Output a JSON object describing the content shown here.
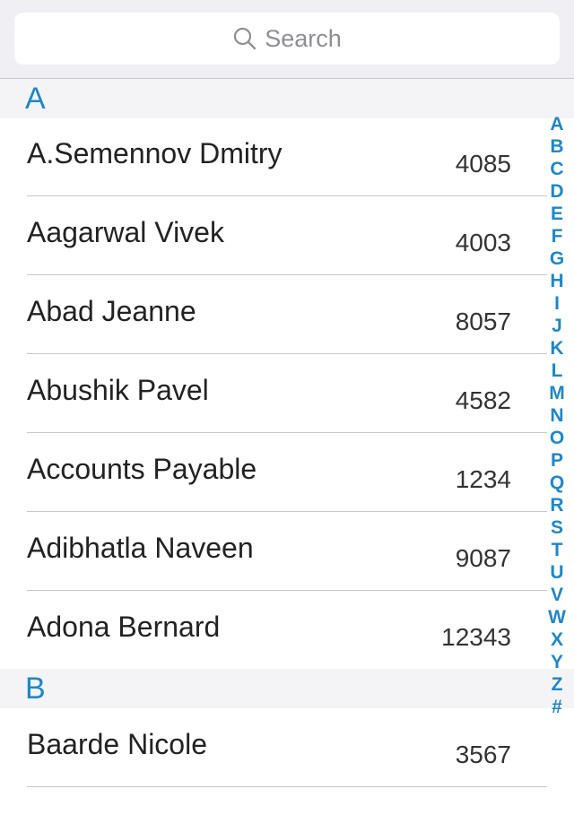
{
  "search": {
    "placeholder": "Search"
  },
  "sections": [
    {
      "letter": "A",
      "rows": [
        {
          "name": "A.Semennov Dmitry",
          "ext": "4085"
        },
        {
          "name": "Aagarwal Vivek",
          "ext": "4003"
        },
        {
          "name": "Abad Jeanne",
          "ext": "8057"
        },
        {
          "name": "Abushik Pavel",
          "ext": "4582"
        },
        {
          "name": "Accounts Payable",
          "ext": "1234"
        },
        {
          "name": "Adibhatla Naveen",
          "ext": "9087"
        },
        {
          "name": "Adona Bernard",
          "ext": "12343"
        }
      ]
    },
    {
      "letter": "B",
      "rows": [
        {
          "name": "Baarde Nicole",
          "ext": "3567"
        }
      ]
    }
  ],
  "index": [
    "A",
    "B",
    "C",
    "D",
    "E",
    "F",
    "G",
    "H",
    "I",
    "J",
    "K",
    "L",
    "M",
    "N",
    "O",
    "P",
    "Q",
    "R",
    "S",
    "T",
    "U",
    "V",
    "W",
    "X",
    "Y",
    "Z",
    "#"
  ],
  "colors": {
    "accent": "#1f87c6",
    "header_bg": "#f4f4f6",
    "search_bg": "#efeff4"
  },
  "icons": {
    "search": "search-icon"
  }
}
